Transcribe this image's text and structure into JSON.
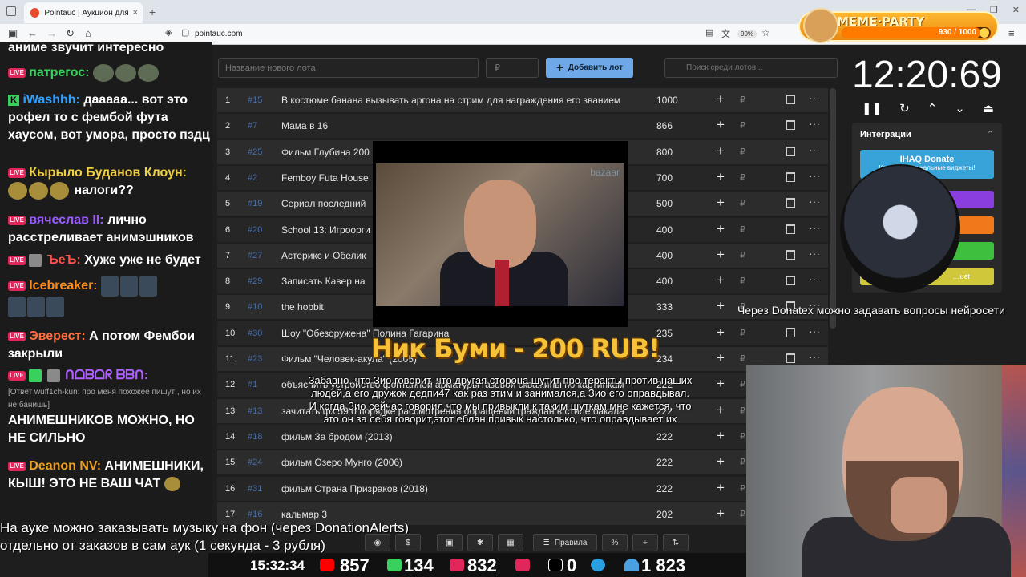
{
  "browser": {
    "tab_title": "Pointauc | Аукцион для стримеров",
    "tab_close": "×",
    "new_tab": "+",
    "url": "pointauc.com",
    "zoom": "90%",
    "window_controls": [
      "—",
      "❐",
      "✕"
    ]
  },
  "meme_party": {
    "title": "MEME·PARTY",
    "count": "930 / 1000",
    "progress": 0.93
  },
  "chat": {
    "messages": [
      {
        "user": "",
        "text": "аниме звучит интересно"
      },
      {
        "user": "патрегос:",
        "text": "",
        "user_color": "#3ad05e"
      },
      {
        "user": "iWashhh:",
        "text": "дааааа... вот это рофел то с фембой фута хаусом, вот умора, просто пздц",
        "user_color": "#2fa0ff"
      },
      {
        "user": "Кырыло Буданов Клоун:",
        "text": "налоги??",
        "user_color": "#f0d040"
      },
      {
        "user": "вячеслав II:",
        "text": "лично расстреливает анимэшников",
        "user_color": "#9a5cff"
      },
      {
        "user": "ЪеЪ:",
        "text": "Хуже уже не будет",
        "user_color": "#ff5050"
      },
      {
        "user": "Icebreaker:",
        "text": "",
        "user_color": "#ff8c1a"
      },
      {
        "user": "Эверест:",
        "text": "А потом Фембои закрыли",
        "user_color": "#ff7040"
      },
      {
        "user": "ᑎᗝᗷᗝᖇ ᗷᗷᑎ:",
        "text": "",
        "user_color": "#b060ff"
      },
      {
        "reply": "[Ответ wuff1ch-kun: про меня похожее пишут , но их не банишь]",
        "text": "АНИМЕШНИКОВ МОЖНО, НО НЕ СИЛЬНО"
      },
      {
        "user": "Deanon NV:",
        "text": "АНИМЕШНИКИ, КЫШ! ЭТО НЕ ВАШ ЧАТ",
        "user_color": "#f0a020"
      }
    ]
  },
  "controls": {
    "lot_placeholder": "Название нового лота",
    "price_placeholder": "₽",
    "add_lot_label": "Добавить лот",
    "search_placeholder": "Поиск среди лотов..."
  },
  "lots": [
    {
      "num": "1",
      "id": "#15",
      "name": "В костюме банана вызывать аргона на стрим для награждения его званием",
      "amount": "1000"
    },
    {
      "num": "2",
      "id": "#7",
      "name": "Мама в 16",
      "amount": "866"
    },
    {
      "num": "3",
      "id": "#25",
      "name": "Фильм Глубина 200",
      "amount": "800"
    },
    {
      "num": "4",
      "id": "#2",
      "name": "Femboy Futa House",
      "amount": "700"
    },
    {
      "num": "5",
      "id": "#19",
      "name": "Сериал последний",
      "amount": "500"
    },
    {
      "num": "6",
      "id": "#20",
      "name": "School 13: Игроорги",
      "amount": "400"
    },
    {
      "num": "7",
      "id": "#27",
      "name": "Астерикс и Обелик",
      "amount": "400"
    },
    {
      "num": "8",
      "id": "#29",
      "name": "Записать Кавер на",
      "amount": "400"
    },
    {
      "num": "9",
      "id": "#10",
      "name": "the hobbit",
      "amount": "333"
    },
    {
      "num": "10",
      "id": "#30",
      "name": "Шоу \"Обезоружена\" Полина Гагарина",
      "amount": "235"
    },
    {
      "num": "11",
      "id": "#23",
      "name": "Фильм \"Человек-акула\" (2005)",
      "amount": "234"
    },
    {
      "num": "12",
      "id": "#1",
      "name": "объяснить устройство фонтанной арматуры газовой скважины по картинкам",
      "amount": "222"
    },
    {
      "num": "13",
      "id": "#13",
      "name": "зачитать фз 59 о порядке рассмотрения обращений граждан в стиле бакала",
      "amount": "222"
    },
    {
      "num": "14",
      "id": "#18",
      "name": "фильм За бродом (2013)",
      "amount": "222"
    },
    {
      "num": "15",
      "id": "#24",
      "name": "фильм Озеро Мунго (2006)",
      "amount": "222"
    },
    {
      "num": "16",
      "id": "#31",
      "name": "фильм Страна Призраков (2018)",
      "amount": "222"
    },
    {
      "num": "17",
      "id": "#16",
      "name": "кальмар 3",
      "amount": "202"
    }
  ],
  "row_symbols": {
    "plus": "+",
    "rub": "₽",
    "dots": "···"
  },
  "donation": {
    "video_watermark": "bazaar",
    "title": "Ник Буми - 200 RUB!",
    "message": "Забавно, что Зио говорит, что другая сторона шутит про теракты против наших людей,а его дружок дедпи47 как раз этим и занимался,а Зио его оправдывал. И когда Зио сейчас говорил,что мы привыкли к таким шуткам,мне кажется, что это он за себя говорит,этот еблан привык настолько, что оправдывает их"
  },
  "timer": {
    "value": "12:20:69",
    "controls": [
      "❚❚",
      "↻",
      "⌃",
      "⌄",
      "⏏"
    ]
  },
  "integrations": {
    "title": "Интеграции",
    "chevron": "⌃",
    "ihaq_label": "IHAQ Donate",
    "ihaq_sub": "Красивые уникальные виджеты!",
    "last_label": "…uet"
  },
  "ticker_right": "Через Donatex можно задавать вопросы нейросети",
  "ticker_bottom": [
    "На ауке можно заказывать музыку на фон (через DonationAlerts)",
    "отдельно от заказов в сам аук (1 секунда - 3 рубля)"
  ],
  "toolbar": [
    "",
    "$",
    "",
    "",
    "",
    "Правила",
    "%",
    "÷",
    "⇅"
  ],
  "stats": {
    "clock": "15:32:34",
    "youtube": "857",
    "kick": "134",
    "vk": "832",
    "rutube": "",
    "r": "0",
    "telegram": "",
    "total": "1 823"
  },
  "colors": {
    "accent": "#6ea8e8",
    "id_color": "#4a6ea8",
    "donation_title": "#f5c238"
  }
}
